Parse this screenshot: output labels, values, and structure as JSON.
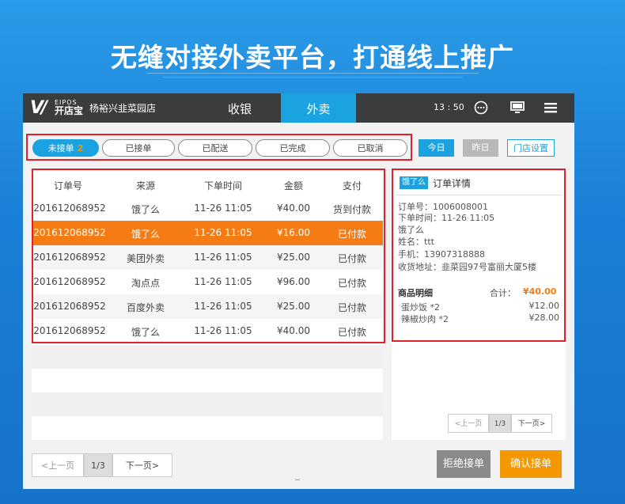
{
  "headline": "无缝对接外卖平台，打通线上推广",
  "app": {
    "logo_mark": "V/",
    "brand_small": "EIPOS",
    "brand_name": "开店宝",
    "store_name": "杨裕兴韭菜园店",
    "tabs": [
      {
        "label": "收银"
      },
      {
        "label": "外卖"
      }
    ],
    "clock": "13 : 50"
  },
  "filters": {
    "tabs": [
      {
        "label": "未接单",
        "badge": "2"
      },
      {
        "label": "已接单"
      },
      {
        "label": "已配送"
      },
      {
        "label": "已完成"
      },
      {
        "label": "已取消"
      }
    ],
    "today": "今日",
    "yesterday": "昨日",
    "store_settings": "门店设置"
  },
  "orders": {
    "headers": [
      "订单号",
      "来源",
      "下单时间",
      "金额",
      "支付"
    ],
    "rows": [
      {
        "id": "201612068952",
        "source": "饿了么",
        "time": "11-26  11:05",
        "amount": "¥40.00",
        "pay": "货到付款"
      },
      {
        "id": "201612068952",
        "source": "饿了么",
        "time": "11-26  11:05",
        "amount": "¥16.00",
        "pay": "已付款"
      },
      {
        "id": "201612068952",
        "source": "美团外卖",
        "time": "11-26  11:05",
        "amount": "¥25.00",
        "pay": "已付款"
      },
      {
        "id": "201612068952",
        "source": "淘点点",
        "time": "11-26  11:05",
        "amount": "¥96.00",
        "pay": "已付款"
      },
      {
        "id": "201612068952",
        "source": "百度外卖",
        "time": "11-26  11:05",
        "amount": "¥25.00",
        "pay": "已付款"
      },
      {
        "id": "201612068952",
        "source": "饿了么",
        "time": "11-26  11:05",
        "amount": "¥40.00",
        "pay": "已付款"
      }
    ],
    "selected_index": 1,
    "pager": {
      "prev": "<上一页",
      "page": "1/3",
      "next": "下一页>"
    }
  },
  "detail": {
    "platform": "饿了么",
    "title": "订单详情",
    "order_no": "订单号：1006008001",
    "order_time": "下单时间：11-26  11:05",
    "source": "饿了么",
    "name": "姓名：ttt",
    "phone": "手机：13907318888",
    "address": "收货地址：韭菜园97号富丽大厦5楼",
    "goods_label": "商品明细",
    "total_label": "合计：",
    "total": "¥40.00",
    "items": [
      {
        "name": "蛋炒饭   *2",
        "price": "¥12.00"
      },
      {
        "name": "辣椒炒肉   *2",
        "price": "¥28.00"
      }
    ],
    "pager": {
      "prev": "<上一页",
      "page": "1/3",
      "next": "下一页>"
    }
  },
  "actions": {
    "reject": "拒绝接单",
    "accept": "确认接单"
  },
  "colors": {
    "accent": "#1aa3e0",
    "selected": "#f57c14",
    "highlight": "#e0202a",
    "accept": "#f39800"
  }
}
